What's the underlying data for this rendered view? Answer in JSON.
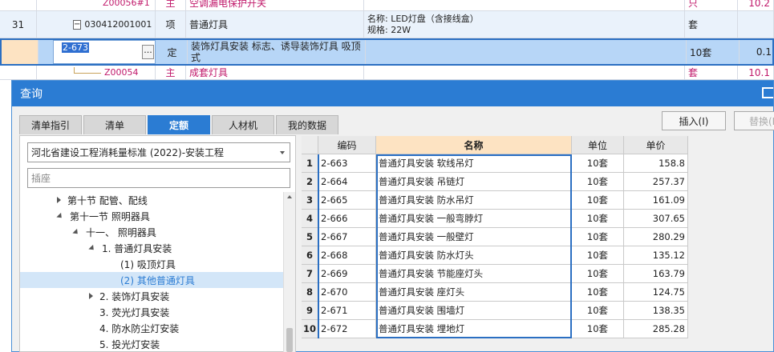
{
  "bg_table": {
    "rows": [
      {
        "num": "",
        "code": "Z00056#1",
        "type": "主",
        "name": "空调漏电保护开关",
        "spec": "",
        "unit": "只",
        "qty": "10.2"
      },
      {
        "num": "31",
        "code": "030412001001",
        "expand": "−",
        "type": "项",
        "name": "普通灯具",
        "spec_line1": "名称: LED灯盘（含接线盒）",
        "spec_line2": "规格: 22W",
        "unit": "套",
        "qty": ""
      },
      {
        "num": "",
        "code": "2-673",
        "dots": "···",
        "type": "定",
        "name": "装饰灯具安装 标志、诱导装饰灯具 吸顶式",
        "spec": "",
        "unit": "10套",
        "qty": "0.1"
      },
      {
        "num": "",
        "code": "Z00054",
        "type": "主",
        "name": "成套灯具",
        "spec": "",
        "unit": "套",
        "qty": "10.1"
      }
    ]
  },
  "dialog": {
    "title": "查询",
    "tabs": [
      {
        "label": "清单指引",
        "active": false
      },
      {
        "label": "清单",
        "active": false
      },
      {
        "label": "定额",
        "active": true
      },
      {
        "label": "人材机",
        "active": false
      },
      {
        "label": "我的数据",
        "active": false
      }
    ],
    "insert_button": "插入(I)",
    "replace_button": "替换(R",
    "library_select": "河北省建设工程消耗量标准 (2022)-安装工程",
    "search_placeholder": "插座",
    "tree": [
      {
        "label": "第十节 配管、配线",
        "indent": 1,
        "toggle": "collapsed"
      },
      {
        "label": "第十一节 照明器具",
        "indent": 1,
        "toggle": "expanded"
      },
      {
        "label": "十一、 照明器具",
        "indent": 2,
        "toggle": "expanded"
      },
      {
        "label": "1. 普通灯具安装",
        "indent": 3,
        "toggle": "expanded"
      },
      {
        "label": "(1) 吸顶灯具",
        "indent": 4,
        "toggle": "none"
      },
      {
        "label": "(2) 其他普通灯具",
        "indent": 4,
        "toggle": "none",
        "selected": true
      },
      {
        "label": "2. 装饰灯具安装",
        "indent": 3,
        "toggle": "collapsed"
      },
      {
        "label": "3. 荧光灯具安装",
        "indent": 3,
        "toggle": "none"
      },
      {
        "label": "4. 防水防尘灯安装",
        "indent": 3,
        "toggle": "none"
      },
      {
        "label": "5. 投光灯安装",
        "indent": 3,
        "toggle": "none"
      }
    ],
    "grid": {
      "headers": {
        "code": "编码",
        "name": "名称",
        "unit": "单位",
        "price": "单价"
      },
      "rows": [
        {
          "idx": "1",
          "code": "2-663",
          "name": "普通灯具安装 软线吊灯",
          "unit": "10套",
          "price": "158.8"
        },
        {
          "idx": "2",
          "code": "2-664",
          "name": "普通灯具安装 吊链灯",
          "unit": "10套",
          "price": "257.37"
        },
        {
          "idx": "3",
          "code": "2-665",
          "name": "普通灯具安装 防水吊灯",
          "unit": "10套",
          "price": "161.09"
        },
        {
          "idx": "4",
          "code": "2-666",
          "name": "普通灯具安装 一般弯脖灯",
          "unit": "10套",
          "price": "307.65"
        },
        {
          "idx": "5",
          "code": "2-667",
          "name": "普通灯具安装 一般壁灯",
          "unit": "10套",
          "price": "280.29"
        },
        {
          "idx": "6",
          "code": "2-668",
          "name": "普通灯具安装 防水灯头",
          "unit": "10套",
          "price": "135.12"
        },
        {
          "idx": "7",
          "code": "2-669",
          "name": "普通灯具安装 节能座灯头",
          "unit": "10套",
          "price": "163.79"
        },
        {
          "idx": "8",
          "code": "2-670",
          "name": "普通灯具安装 座灯头",
          "unit": "10套",
          "price": "124.75"
        },
        {
          "idx": "9",
          "code": "2-671",
          "name": "普通灯具安装 围墙灯",
          "unit": "10套",
          "price": "138.35"
        },
        {
          "idx": "10",
          "code": "2-672",
          "name": "普通灯具安装 埋地灯",
          "unit": "10套",
          "price": "285.28"
        }
      ]
    }
  }
}
